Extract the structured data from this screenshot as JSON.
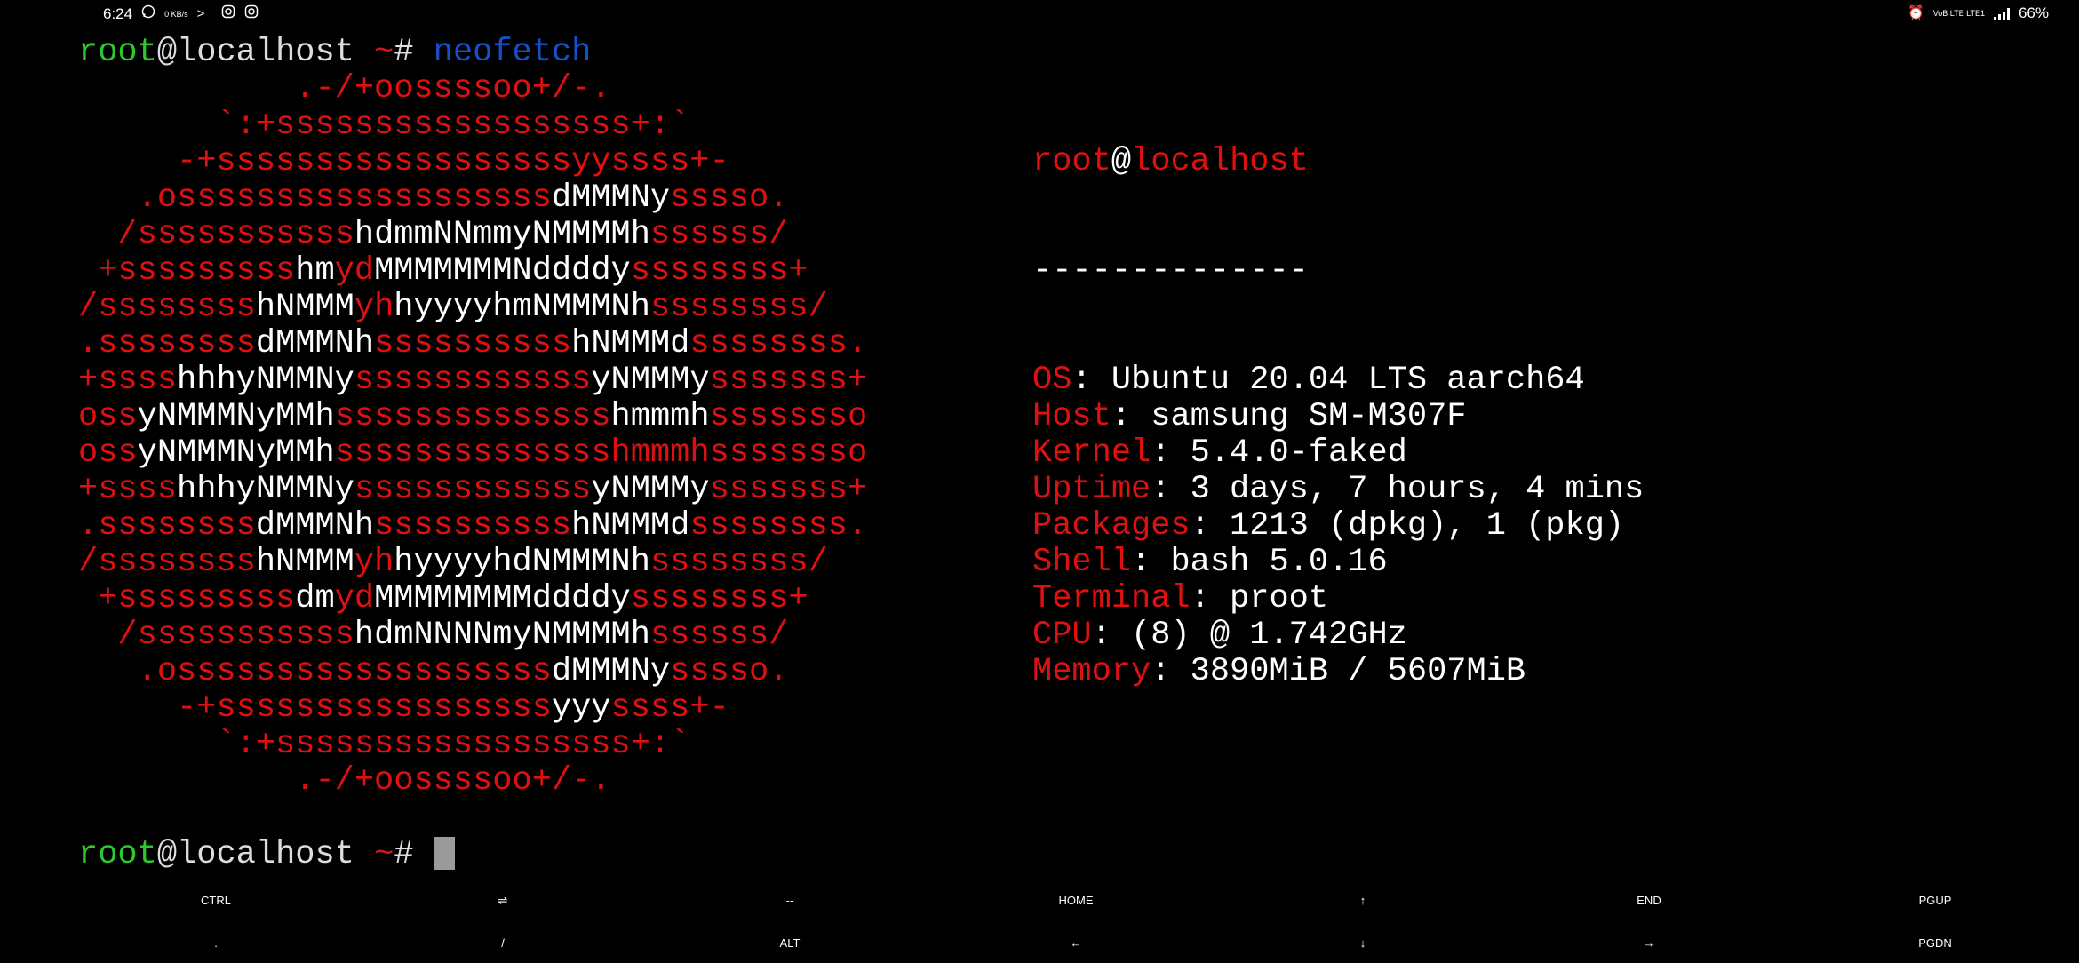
{
  "status_bar": {
    "time": "6:24",
    "icons_left": [
      "whatsapp-icon",
      "data-speed-icon",
      "terminal-icon",
      "instagram-icon",
      "instagram-icon"
    ],
    "data_speed": "0 KB/s",
    "icons_right": [
      "alarm-icon",
      "volte-lte-icon",
      "signal-icon"
    ],
    "network_label": "VoB LTE LTE1",
    "battery": "66%"
  },
  "terminal": {
    "prompt_user": "root",
    "prompt_at": "@",
    "prompt_host": "localhost",
    "prompt_tilde": " ~",
    "prompt_hash": "# ",
    "command": "neofetch",
    "logo_lines": [
      [
        {
          "t": "           .-/+oossssoo+/-.",
          "c": "r"
        }
      ],
      [
        {
          "t": "       `:+ssssssssssssssssss+:`",
          "c": "r"
        }
      ],
      [
        {
          "t": "     -+ssssssssssssssssssyyssss+-",
          "c": "r"
        }
      ],
      [
        {
          "t": "   .osssssssssssssssssss",
          "c": "r"
        },
        {
          "t": "dMMMNy",
          "c": "w"
        },
        {
          "t": "sssso.",
          "c": "r"
        }
      ],
      [
        {
          "t": "  /sssssssssss",
          "c": "r"
        },
        {
          "t": "hdmmNNmmyNMMMMh",
          "c": "w"
        },
        {
          "t": "ssssss/",
          "c": "r"
        }
      ],
      [
        {
          "t": " +sssssssss",
          "c": "r"
        },
        {
          "t": "hm",
          "c": "w"
        },
        {
          "t": "yd",
          "c": "r"
        },
        {
          "t": "MMMMMMMNddddy",
          "c": "w"
        },
        {
          "t": "ssssssss+",
          "c": "r"
        }
      ],
      [
        {
          "t": "/ssssssss",
          "c": "r"
        },
        {
          "t": "hNMMM",
          "c": "w"
        },
        {
          "t": "yh",
          "c": "r"
        },
        {
          "t": "hyyyyhmNMMMNh",
          "c": "w"
        },
        {
          "t": "ssssssss/",
          "c": "r"
        }
      ],
      [
        {
          "t": ".ssssssss",
          "c": "r"
        },
        {
          "t": "dMMMNh",
          "c": "w"
        },
        {
          "t": "ssssssssss",
          "c": "r"
        },
        {
          "t": "hNMMMd",
          "c": "w"
        },
        {
          "t": "ssssssss.",
          "c": "r"
        }
      ],
      [
        {
          "t": "+ssss",
          "c": "r"
        },
        {
          "t": "hhhyNMMNy",
          "c": "w"
        },
        {
          "t": "ssssssssssss",
          "c": "r"
        },
        {
          "t": "yNMMMy",
          "c": "w"
        },
        {
          "t": "sssssss+",
          "c": "r"
        }
      ],
      [
        {
          "t": "oss",
          "c": "r"
        },
        {
          "t": "yNMMMNyMMh",
          "c": "w"
        },
        {
          "t": "ssssssssssssss",
          "c": "r"
        },
        {
          "t": "hmmmh",
          "c": "w"
        },
        {
          "t": "ssssssso",
          "c": "r"
        }
      ],
      [
        {
          "t": "oss",
          "c": "r"
        },
        {
          "t": "yNMMMNyMMh",
          "c": "w"
        },
        {
          "t": "sssssssssssssshmmmhssssssso",
          "c": "r"
        }
      ],
      [
        {
          "t": "+ssss",
          "c": "r"
        },
        {
          "t": "hhhyNMMNy",
          "c": "w"
        },
        {
          "t": "ssssssssssss",
          "c": "r"
        },
        {
          "t": "yNMMMy",
          "c": "w"
        },
        {
          "t": "sssssss+",
          "c": "r"
        }
      ],
      [
        {
          "t": ".ssssssss",
          "c": "r"
        },
        {
          "t": "dMMMNh",
          "c": "w"
        },
        {
          "t": "ssssssssss",
          "c": "r"
        },
        {
          "t": "hNMMMd",
          "c": "w"
        },
        {
          "t": "ssssssss.",
          "c": "r"
        }
      ],
      [
        {
          "t": "/ssssssss",
          "c": "r"
        },
        {
          "t": "hNMMM",
          "c": "w"
        },
        {
          "t": "yh",
          "c": "r"
        },
        {
          "t": "hyyyyhdNMMMNh",
          "c": "w"
        },
        {
          "t": "ssssssss/",
          "c": "r"
        }
      ],
      [
        {
          "t": " +sssssssss",
          "c": "r"
        },
        {
          "t": "dm",
          "c": "w"
        },
        {
          "t": "yd",
          "c": "r"
        },
        {
          "t": "MMMMMMMMddddy",
          "c": "w"
        },
        {
          "t": "ssssssss+",
          "c": "r"
        }
      ],
      [
        {
          "t": "  /sssssssssss",
          "c": "r"
        },
        {
          "t": "hdmNNNNmyNMMMMh",
          "c": "w"
        },
        {
          "t": "ssssss/",
          "c": "r"
        }
      ],
      [
        {
          "t": "   .osssssssssssssssssss",
          "c": "r"
        },
        {
          "t": "dMMMNy",
          "c": "w"
        },
        {
          "t": "sssso.",
          "c": "r"
        }
      ],
      [
        {
          "t": "     -+sssssssssssssssss",
          "c": "r"
        },
        {
          "t": "yyy",
          "c": "w"
        },
        {
          "t": "ssss+-",
          "c": "r"
        }
      ],
      [
        {
          "t": "       `:+ssssssssssssssssss+:`",
          "c": "r"
        }
      ],
      [
        {
          "t": "           .-/+oossssoo+/-.",
          "c": "r"
        }
      ]
    ],
    "info_header": {
      "user": "root",
      "at": "@",
      "host": "localhost",
      "separator": "--------------"
    },
    "info": [
      {
        "label": "OS",
        "value": ": Ubuntu 20.04 LTS aarch64"
      },
      {
        "label": "Host",
        "value": ": samsung SM-M307F"
      },
      {
        "label": "Kernel",
        "value": ": 5.4.0-faked"
      },
      {
        "label": "Uptime",
        "value": ": 3 days, 7 hours, 4 mins"
      },
      {
        "label": "Packages",
        "value": ": 1213 (dpkg), 1 (pkg)"
      },
      {
        "label": "Shell",
        "value": ": bash 5.0.16"
      },
      {
        "label": "Terminal",
        "value": ": proot"
      },
      {
        "label": "CPU",
        "value": ": (8) @ 1.742GHz"
      },
      {
        "label": "Memory",
        "value": ": 3890MiB / 5607MiB"
      }
    ]
  },
  "extra_keys": {
    "row1": [
      "CTRL",
      "⇌",
      "--",
      "HOME",
      "↑",
      "END",
      "PGUP"
    ],
    "row2": [
      ".",
      "/",
      "ALT",
      "←",
      "↓",
      "→",
      "PGDN"
    ]
  },
  "colors": {
    "red": "#e01010",
    "green": "#2ec82e",
    "blue": "#1650c8",
    "cursor": "#9a9a9a"
  }
}
